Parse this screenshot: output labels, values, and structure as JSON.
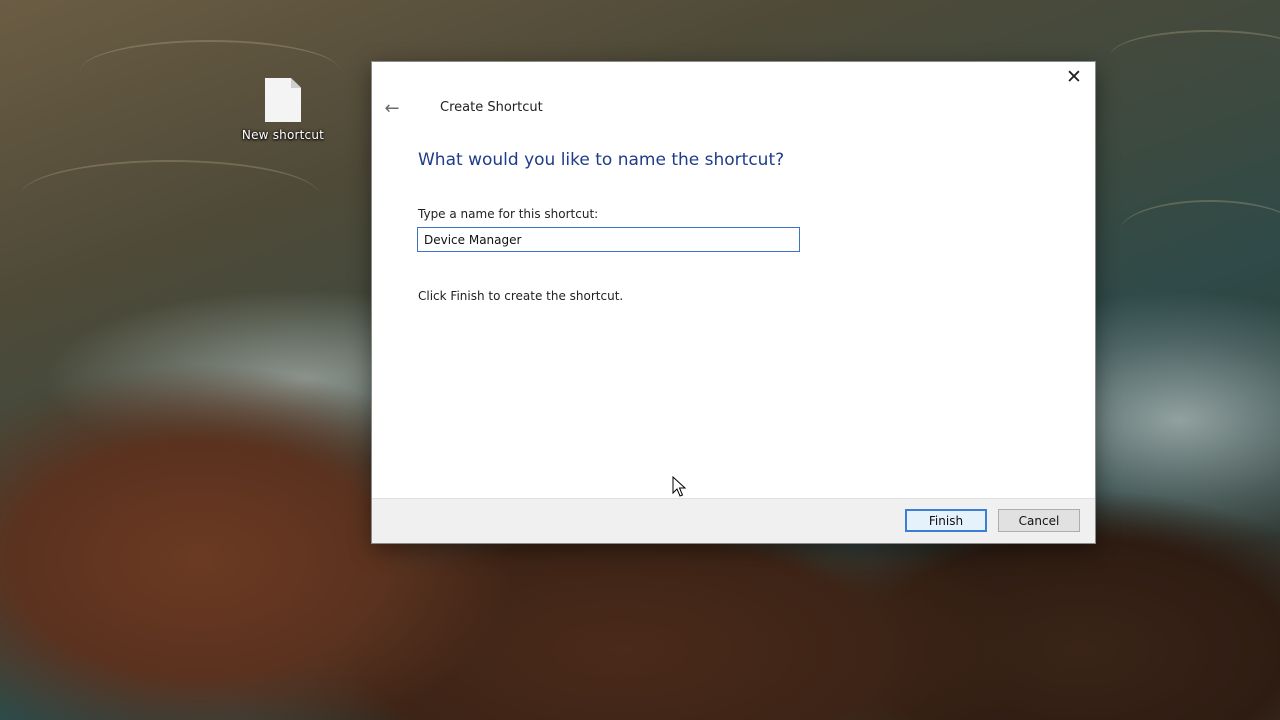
{
  "desktop": {
    "icons": [
      {
        "label": "New shortcut",
        "icon": "blank-file-icon"
      }
    ]
  },
  "dialog": {
    "title": "Create Shortcut",
    "heading": "What would you like to name the shortcut?",
    "field_label": "Type a name for this shortcut:",
    "name_value": "Device Manager",
    "info_text": "Click Finish to create the shortcut.",
    "close_glyph": "✕",
    "back_glyph": "←",
    "buttons": {
      "finish": "Finish",
      "cancel": "Cancel"
    }
  },
  "colors": {
    "heading": "#1f3c8a",
    "input_border": "#3c74c8",
    "default_button_border": "#3a7fd4",
    "footer_bg": "#f0f0f0"
  }
}
